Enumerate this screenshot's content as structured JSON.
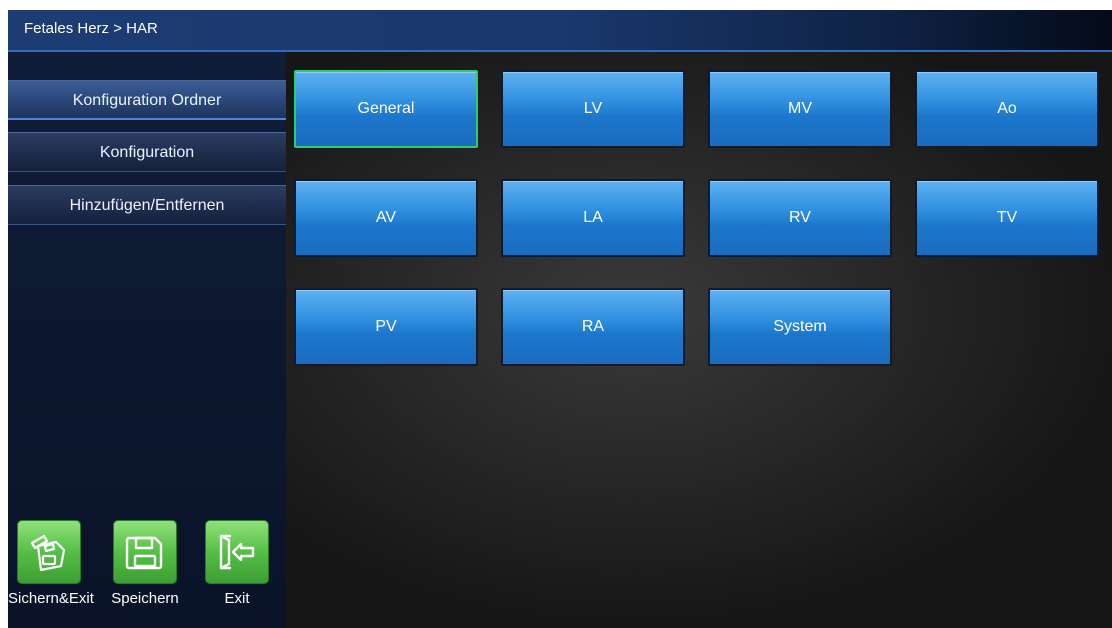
{
  "header": {
    "breadcrumb": "Fetales Herz > HAR"
  },
  "sidebar": {
    "items": [
      {
        "label": "Konfiguration Ordner"
      },
      {
        "label": "Konfiguration"
      },
      {
        "label": "Hinzufügen/Entfernen"
      }
    ]
  },
  "grid": {
    "tiles": [
      "General",
      "LV",
      "MV",
      "Ao",
      "AV",
      "LA",
      "RV",
      "TV",
      "PV",
      "RA",
      "System"
    ],
    "selected": "General"
  },
  "toolbar": {
    "save_exit_label": "Sichern&Exit",
    "save_label": "Speichern",
    "exit_label": "Exit"
  },
  "colors": {
    "tile_blue": "#2f8fdf",
    "selected_border": "#2ecc71",
    "tool_green": "#55bf46"
  }
}
